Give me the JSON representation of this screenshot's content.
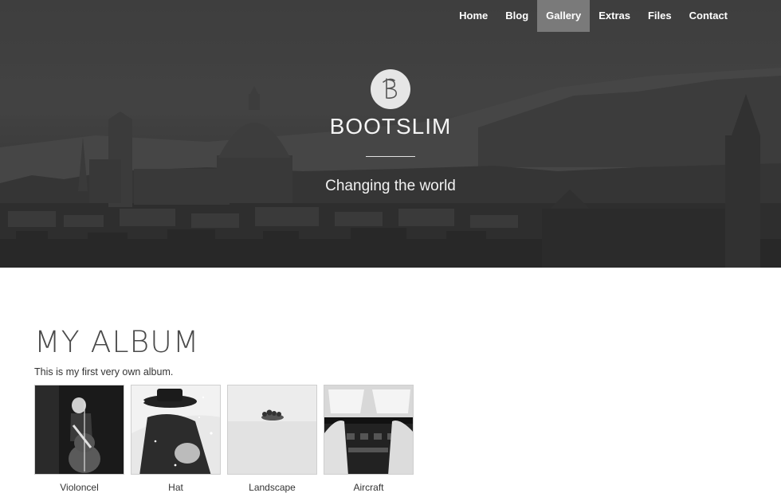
{
  "nav": {
    "items": [
      {
        "label": "Home",
        "active": false
      },
      {
        "label": "Blog",
        "active": false
      },
      {
        "label": "Gallery",
        "active": true
      },
      {
        "label": "Extras",
        "active": false
      },
      {
        "label": "Files",
        "active": false
      },
      {
        "label": "Contact",
        "active": false
      }
    ]
  },
  "hero": {
    "logo_icon": "bootslim-b-logo",
    "site_title": "BOOTSLIM",
    "tagline": "Changing the world"
  },
  "album": {
    "title": "MY ALBUM",
    "description": "This is my first very own album.",
    "photos": [
      {
        "caption": "Violoncel",
        "icon": "cellist-photo"
      },
      {
        "caption": "Hat",
        "icon": "hat-man-photo"
      },
      {
        "caption": "Landscape",
        "icon": "landscape-photo"
      },
      {
        "caption": "Aircraft",
        "icon": "cockpit-photo"
      }
    ]
  },
  "colors": {
    "nav_active_bg": "#7a7a7a",
    "hero_overlay": "#424242",
    "text": "#444444"
  }
}
